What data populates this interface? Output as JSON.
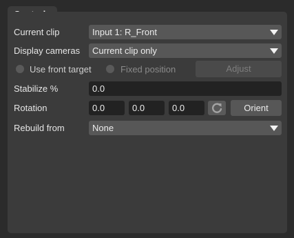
{
  "panel": {
    "tab_label": "Controls"
  },
  "current_clip": {
    "label": "Current clip",
    "value": "Input 1: R_Front"
  },
  "display_cameras": {
    "label": "Display cameras",
    "value": "Current clip only"
  },
  "target": {
    "front_label": "Use front target",
    "fixed_label": "Fixed position",
    "adjust_label": "Adjust"
  },
  "stabilize": {
    "label": "Stabilize %",
    "value": "0.0"
  },
  "rotation": {
    "label": "Rotation",
    "x": "0.0",
    "y": "0.0",
    "z": "0.0",
    "orient_label": "Orient"
  },
  "rebuild": {
    "label": "Rebuild from",
    "value": "None"
  },
  "icons": {
    "dropdown": "chevron-down-icon",
    "reset": "refresh-icon",
    "radio": "radio-icon"
  },
  "colors": {
    "background": "#2b2b2b",
    "panel": "#3b3b3b",
    "dropdown": "#575757",
    "field": "#222222",
    "disabled_text": "#8a8a8a"
  }
}
